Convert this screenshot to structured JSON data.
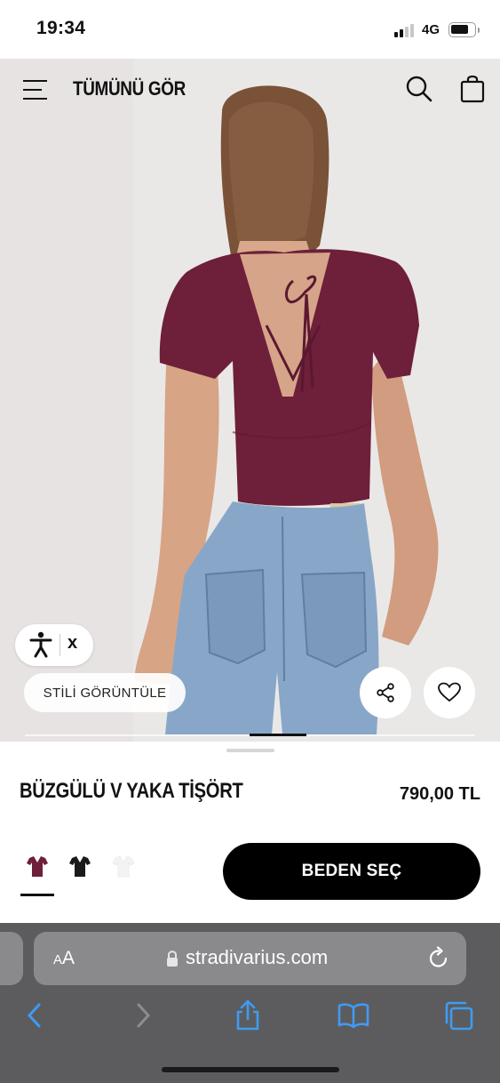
{
  "status_bar": {
    "time": "19:34",
    "network": "4G"
  },
  "header": {
    "title": "TÜMÜNÜ GÖR",
    "icons": [
      "menu-icon",
      "search-icon",
      "shopping-bag-icon"
    ]
  },
  "image_overlay": {
    "accessibility_close": "x",
    "view_style_label": "STİLİ GÖRÜNTÜLE",
    "icons": [
      "accessibility-icon",
      "share-icon",
      "heart-icon"
    ]
  },
  "product": {
    "name": "BÜZGÜLÜ V YAKA TİŞÖRT",
    "price": "790,00 TL",
    "swatches": [
      {
        "name": "burgundy",
        "color": "#6e1f3a",
        "selected": true
      },
      {
        "name": "black",
        "color": "#1a1a1a",
        "selected": false
      },
      {
        "name": "white",
        "color": "#f3f3f3",
        "selected": false
      }
    ],
    "select_size_label": "BEDEN SEÇ"
  },
  "browser": {
    "text_size_label_small": "A",
    "text_size_label_large": "A",
    "url": "stradivarius.com",
    "icons": [
      "lock-icon",
      "reload-icon",
      "back-icon",
      "forward-icon",
      "share-icon",
      "bookmarks-icon",
      "tabs-icon"
    ]
  },
  "colors": {
    "accent": "#000000",
    "shirt": "#6e1f3a",
    "safari_toolbar": "#5c5c5e",
    "link_blue": "#3f9bf4"
  }
}
